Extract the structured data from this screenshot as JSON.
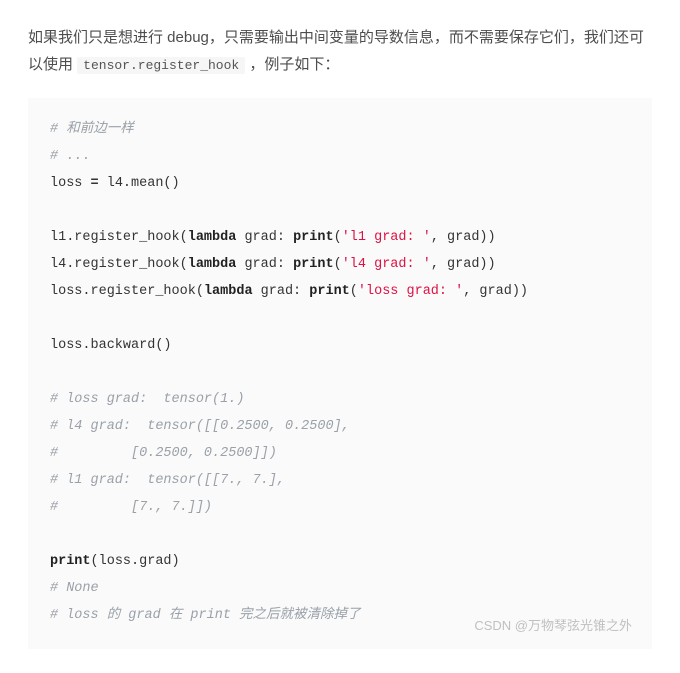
{
  "desc": {
    "part1": "如果我们只是想进行 debug，只需要输出中间变量的导数信息，而不需要保存它们，我们还可以使用 ",
    "inline_code": "tensor.register_hook",
    "part2": " ，例子如下："
  },
  "code": {
    "c1": "# 和前边一样",
    "c2": "# ...",
    "l3a": "loss ",
    "l3op": "=",
    "l3b": " l4.mean()",
    "l5a": "l1.register_hook(",
    "kw_lambda": "lambda",
    "l5b": " grad: ",
    "kw_print": "print",
    "l5c": "(",
    "s1": "'l1 grad: '",
    "l5d": ", grad))",
    "l6a": "l4.register_hook(",
    "l6c": "(",
    "s2": "'l4 grad: '",
    "l6d": ", grad))",
    "l7a": "loss.register_hook(",
    "l7c": "(",
    "s3": "'loss grad: '",
    "l7d": ", grad))",
    "l9": "loss.backward()",
    "c11": "# loss grad:  tensor(1.)",
    "c12": "# l4 grad:  tensor([[0.2500, 0.2500],",
    "c13": "#         [0.2500, 0.2500]])",
    "c14": "# l1 grad:  tensor([[7., 7.],",
    "c15": "#         [7., 7.]])",
    "l17a": "print",
    "l17b": "(loss.grad)",
    "c18": "# None",
    "c19": "# loss 的 grad 在 print 完之后就被清除掉了"
  },
  "watermark": "CSDN @万物琴弦光锥之外"
}
